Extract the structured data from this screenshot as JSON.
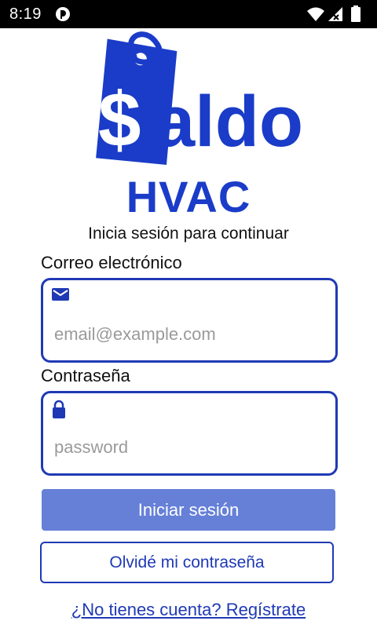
{
  "status_bar": {
    "time": "8:19"
  },
  "brand": {
    "logo_text": "Saldo",
    "name": "HVAC",
    "color": "#1a3cc8"
  },
  "login": {
    "subtitle": "Inicia sesión para continuar",
    "email": {
      "label": "Correo electrónico",
      "placeholder": "email@example.com",
      "icon": "mail-icon"
    },
    "password": {
      "label": "Contraseña",
      "placeholder": "password",
      "icon": "lock-icon"
    },
    "submit_label": "Iniciar sesión",
    "forgot_label": "Olvidé mi contraseña",
    "register_label": "¿No tienes cuenta? Regístrate"
  }
}
